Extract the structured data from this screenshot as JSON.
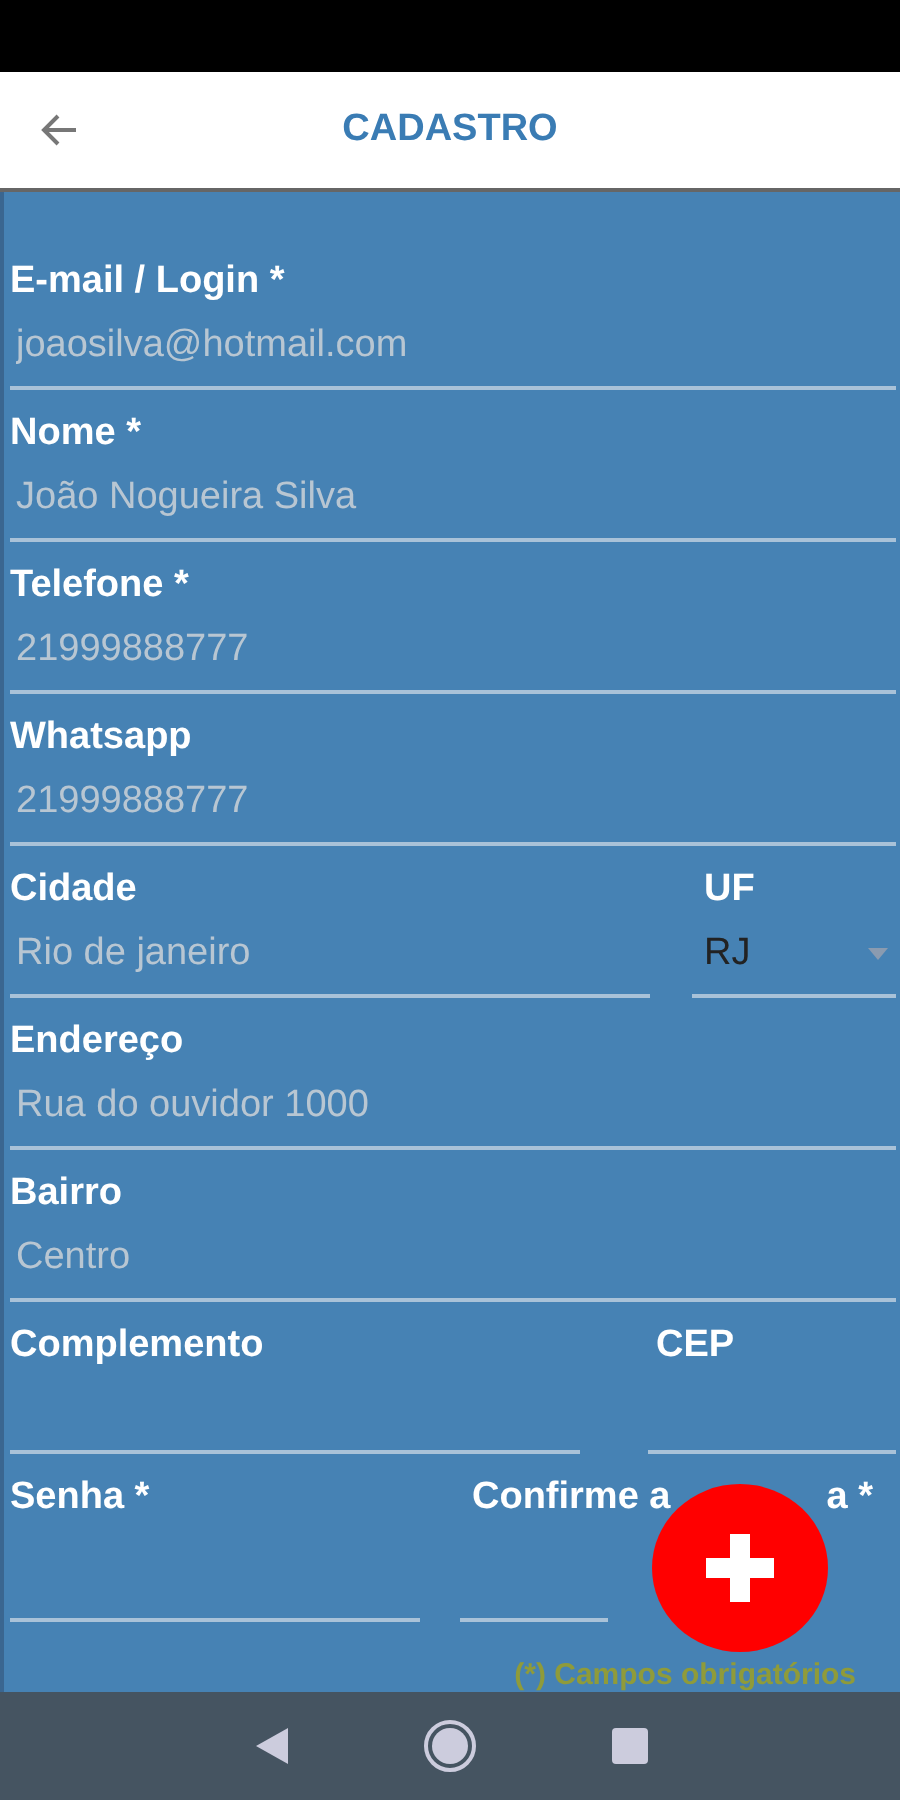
{
  "header": {
    "title": "CADASTRO"
  },
  "rows": [
    [
      {
        "label": "E-mail / Login *",
        "placeholder": "joaosilva@hotmail.com",
        "kind": "text"
      }
    ],
    [
      {
        "label": "Nome *",
        "placeholder": "João Nogueira Silva",
        "kind": "text"
      }
    ],
    [
      {
        "label": "Telefone *",
        "placeholder": "21999888777",
        "kind": "text"
      }
    ],
    [
      {
        "label": "Whatsapp",
        "placeholder": "21999888777",
        "kind": "text"
      }
    ],
    [
      {
        "label": "Cidade",
        "placeholder": "Rio de janeiro",
        "kind": "text"
      },
      {
        "label": "UF",
        "value": "RJ",
        "kind": "select"
      }
    ],
    [
      {
        "label": "Endereço",
        "placeholder": "Rua do ouvidor 1000",
        "kind": "text"
      }
    ],
    [
      {
        "label": "Bairro",
        "placeholder": "Centro",
        "kind": "text"
      }
    ],
    [
      {
        "label": "Complemento",
        "kind": "text"
      },
      {
        "label": "CEP",
        "kind": "text"
      }
    ],
    [
      {
        "label": "Senha *",
        "kind": "password"
      },
      {
        "label": "Confirme a",
        "label_tail": "a *",
        "kind": "password"
      }
    ]
  ],
  "footnote": "(*) Campos obrigatórios"
}
